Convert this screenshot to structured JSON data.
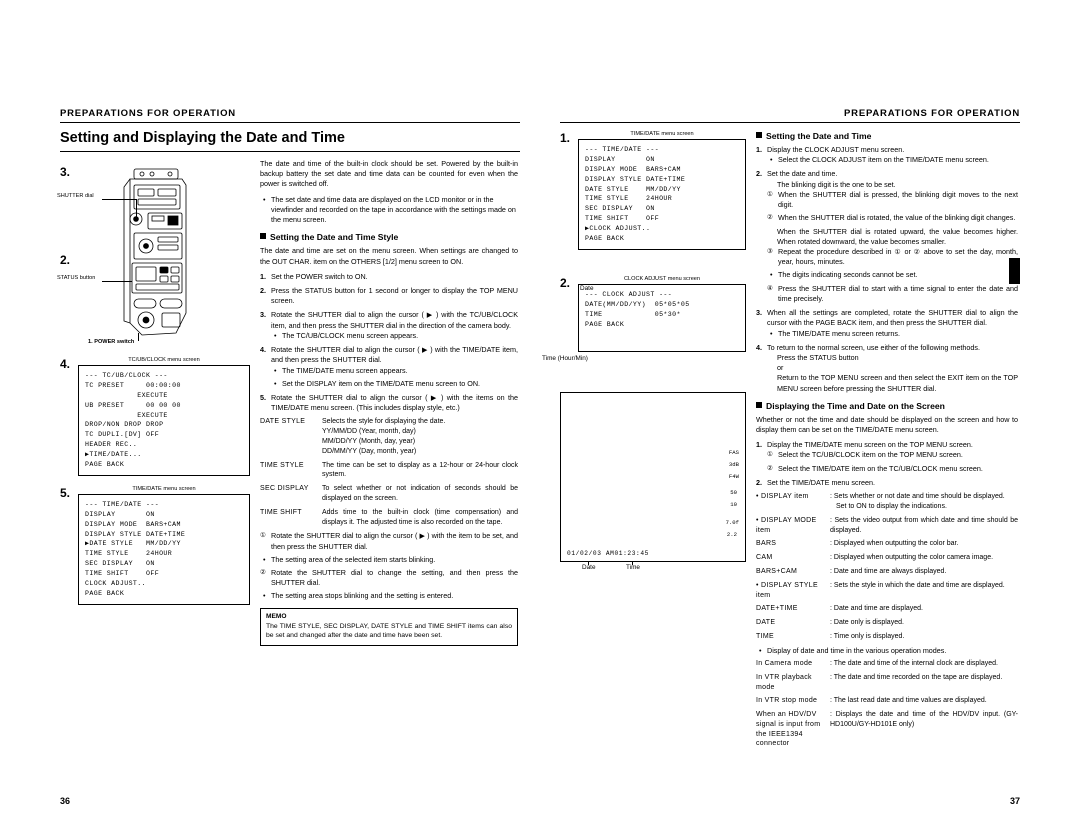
{
  "left": {
    "running_head": "PREPARATIONS FOR OPERATION",
    "page_title": "Setting and Displaying the Date and Time",
    "page_number": "36",
    "intro": [
      "The date and time of the built-in clock should be set. Powered by the built-in backup battery the set date and time data can be counted for even when the power is switched off.",
      "The set date and time data are displayed on the LCD monitor or in the viewfinder and recorded on the tape in accordance with the settings made on the menu screen."
    ],
    "section1_title": "Setting the Date and Time Style",
    "section1_lead": "The date and time are set on the menu screen. When settings are changed to the OUT CHAR. item on the OTHERS [1/2] menu screen to ON.",
    "steps": [
      {
        "n": "1.",
        "text": "Set the POWER switch to ON."
      },
      {
        "n": "2.",
        "text": "Press the STATUS button for 1 second or longer to display the TOP MENU screen."
      },
      {
        "n": "3.",
        "text": "Rotate the SHUTTER dial to align the cursor ( ▶ ) with the TC/UB/CLOCK item, and then press the SHUTTER dial in the direction of the camera body.",
        "bullets": [
          "The TC/UB/CLOCK menu screen appears."
        ]
      },
      {
        "n": "4.",
        "text": "Rotate the SHUTTER dial to align the cursor ( ▶ ) with the TIME/DATE item, and then press the SHUTTER dial.",
        "bullets": [
          "The TIME/DATE menu screen appears.",
          "Set the DISPLAY item on the TIME/DATE menu screen to ON."
        ]
      },
      {
        "n": "5.",
        "text": "Rotate the SHUTTER dial to align the cursor ( ▶ ) with the items on the TIME/DATE menu screen. (This includes display style, etc.)"
      }
    ],
    "defs": [
      {
        "term": "DATE STYLE",
        "desc": "Selects the style for displaying the date.",
        "lines": [
          "YY/MM/DD (Year, month, day)",
          "MM/DD/YY (Month, day, year)",
          "DD/MM/YY (Day, month, year)"
        ]
      },
      {
        "term": "TIME STYLE",
        "desc": "The time can be set to display as a 12-hour or 24-hour clock system.",
        "lines": []
      },
      {
        "term": "SEC DISPLAY",
        "desc": "To select whether or not indication of seconds should be displayed on the screen.",
        "lines": []
      },
      {
        "term": "TIME SHIFT",
        "desc": "Adds time to the built-in clock (time compensation) and displays it. The adjusted time is also recorded on the tape.",
        "lines": []
      }
    ],
    "circled": [
      {
        "c": "①",
        "text": "Rotate the SHUTTER dial to align the cursor ( ▶ ) with the item to be set, and then press the SHUTTER dial.",
        "bullet": "The setting area of the selected item starts blinking."
      },
      {
        "c": "②",
        "text": "Rotate the SHUTTER dial to change the setting, and then press the SHUTTER dial.",
        "bullet": "The setting area stops blinking and the setting is entered."
      }
    ],
    "memo_title": "MEMO",
    "memo_text": "The TIME STYLE, SEC DISPLAY, DATE STYLE and TIME SHIFT items can also be set and changed after the date and time have been set.",
    "callouts": {
      "shutter_dial": "SHUTTER dial",
      "status_button": "STATUS button",
      "power_switch": "1. POWER switch",
      "marker3": "3.",
      "marker2": "2."
    },
    "screens": [
      {
        "n": "4.",
        "caption": "TC/UB/CLOCK menu screen",
        "lines": [
          "--- TC/UB/CLOCK ---",
          "TC PRESET     00:00:00",
          "            EXECUTE",
          "UB PRESET     00 00 00",
          "            EXECUTE",
          "DROP/NON DROP DROP",
          "TC DUPLI.[DV] OFF",
          "HEADER REC..",
          "▶TIME/DATE...",
          "PAGE BACK"
        ]
      },
      {
        "n": "5.",
        "caption": "TIME/DATE menu screen",
        "lines": [
          "--- TIME/DATE ---",
          "DISPLAY       ON",
          "DISPLAY MODE  BARS+CAM",
          "DISPLAY STYLE DATE+TIME",
          "▶DATE STYLE   MM/DD/YY",
          "TIME STYLE    24HOUR",
          "SEC DISPLAY   ON",
          "TIME SHIFT    OFF",
          "CLOCK ADJUST..",
          "PAGE BACK"
        ]
      }
    ]
  },
  "right": {
    "running_head": "PREPARATIONS FOR OPERATION",
    "page_number": "37",
    "screens": [
      {
        "n": "1.",
        "caption": "TIME/DATE menu screen",
        "lines": [
          "--- TIME/DATE ---",
          "DISPLAY       ON",
          "DISPLAY MODE  BARS+CAM",
          "DISPLAY STYLE DATE+TIME",
          "DATE STYLE    MM/DD/YY",
          "TIME STYLE    24HOUR",
          "SEC DISPLAY   ON",
          "TIME SHIFT    OFF",
          "▶CLOCK ADJUST..",
          "PAGE BACK"
        ]
      },
      {
        "n": "2.",
        "caption": "CLOCK ADJUST menu screen",
        "lines": [
          "--- CLOCK ADJUST ---",
          "DATE(MM/DD/YY)  05*05*05",
          "TIME            05*30*",
          "PAGE BACK"
        ],
        "label_date": "Date",
        "label_time": "Time (Hour/Min)"
      }
    ],
    "section1_title": "Setting the Date and Time",
    "steps": [
      {
        "n": "1.",
        "text": "Display the CLOCK ADJUST menu screen.",
        "bullets": [
          "Select the CLOCK ADJUST item on the TIME/DATE menu screen."
        ]
      },
      {
        "n": "2.",
        "text": "Set the date and time.",
        "sub": "The blinking digit is the one to be set.",
        "circled": [
          {
            "c": "①",
            "text": "When the SHUTTER dial is pressed, the blinking digit moves to the next digit."
          },
          {
            "c": "②",
            "text": "When the SHUTTER dial is rotated, the value of the blinking digit changes.",
            "extra": "When the SHUTTER dial is rotated upward, the value becomes higher. When rotated downward, the value becomes smaller."
          },
          {
            "c": "③",
            "text": "Repeat the procedure described in ① or ② above to set the day, month, year, hours, minutes.",
            "bullets": [
              "The digits indicating seconds cannot be set."
            ]
          },
          {
            "c": "④",
            "text": "Press the SHUTTER dial to start with a time signal to enter the date and time precisely."
          }
        ]
      },
      {
        "n": "3.",
        "text": "When all the settings are completed, rotate the SHUTTER dial to align the cursor with the PAGE BACK item, and then press the SHUTTER dial.",
        "bullets": [
          "The TIME/DATE menu screen returns."
        ]
      },
      {
        "n": "4.",
        "text": "To return to the normal screen, use either of the following methods.",
        "lines": [
          "Press the STATUS button",
          "or",
          "Return to the TOP MENU screen and then select the EXIT item on the TOP MENU screen before pressing the SHUTTER dial."
        ]
      }
    ],
    "section2_title": "Displaying the Time and Date on the Screen",
    "section2_lead": "Whether or not the time and date should be displayed on the screen and how to display them can be set on the TIME/DATE menu screen.",
    "steps2": [
      {
        "n": "1.",
        "text": "Display the TIME/DATE menu screen on the TOP MENU screen.",
        "circled": [
          {
            "c": "①",
            "text": "Select the TC/UB/CLOCK item on the TOP MENU screen."
          },
          {
            "c": "②",
            "text": "Select the TIME/DATE item on the TC/UB/CLOCK menu screen."
          }
        ]
      },
      {
        "n": "2.",
        "text": "Set the TIME/DATE menu screen."
      }
    ],
    "defs": [
      {
        "term": "DISPLAY item",
        "desc": "Sets whether or not date and time should be displayed.",
        "lines": [
          "Set to ON to display the indications."
        ]
      },
      {
        "term": "DISPLAY MODE item",
        "desc": "Sets the video output from which date and time should be displayed.",
        "lines": []
      },
      {
        "term": "BARS",
        "desc": "Displayed when outputting the color bar.",
        "lines": []
      },
      {
        "term": "CAM",
        "desc": "Displayed when outputting the color camera image.",
        "lines": []
      },
      {
        "term": "BARS+CAM",
        "desc": "Date and time are always displayed.",
        "lines": []
      },
      {
        "term": "DISPLAY STYLE item",
        "desc": "Sets the style in which the date and time are displayed.",
        "lines": []
      },
      {
        "term": "DATE+TIME",
        "desc": "Date and time are displayed.",
        "lines": []
      },
      {
        "term": "DATE",
        "desc": "Date only is displayed.",
        "lines": []
      },
      {
        "term": "TIME",
        "desc": "Time only is displayed.",
        "lines": []
      }
    ],
    "display_note": "Display of date and time in the various operation modes.",
    "modes": [
      {
        "term": "In Camera mode",
        "desc": "The date and time of the internal clock are displayed."
      },
      {
        "term": "In VTR playback mode",
        "desc": "The date and time recorded on the tape are displayed."
      },
      {
        "term": "In VTR stop mode",
        "desc": "The last read date and time values are displayed."
      },
      {
        "term": "When an HDV/DV signal is input from the IEEE1394 connector",
        "desc": "Displays the date and time of the HDV/DV input. (GY-HD100U/GY-HD101E only)"
      }
    ],
    "viewfinder": {
      "right_labels": [
        "FAS",
        "3dB",
        "F4W",
        "50",
        "10",
        "",
        "7.0f",
        "2.2"
      ],
      "bottom_text": "01/02/03 AM01:23:45",
      "cap_date": "Date",
      "cap_time": "Time"
    }
  }
}
